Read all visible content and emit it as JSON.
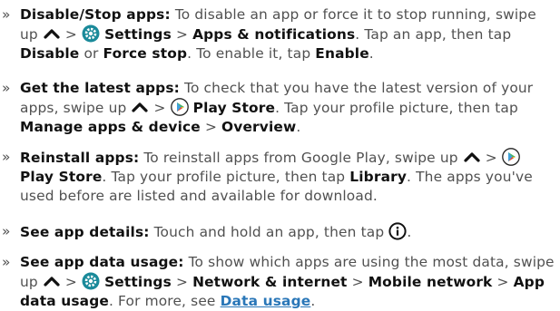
{
  "items": [
    {
      "head": "Disable/Stop apps:",
      "a": "To disable an app or force it to stop running, swipe up",
      "gt1": ">",
      "b1": "Settings",
      "gt2": ">",
      "b2": "Apps & notifications",
      "c": ". Tap an app, then tap",
      "b3": "Disable",
      "or": "or",
      "b4": "Force stop",
      "d": ". To enable it, tap",
      "b5": "Enable",
      "end": "."
    },
    {
      "head": "Get the latest apps:",
      "a": "To check that you have the latest version of your apps, swipe up",
      "gt1": ">",
      "b1": "Play Store",
      "c": ". Tap your profile picture, then tap",
      "b2": "Manage apps & device",
      "gt2": ">",
      "b3": "Overview",
      "end": "."
    },
    {
      "head": "Reinstall apps:",
      "a": "To reinstall apps from Google Play, swipe up",
      "gt1": ">",
      "b1": "Play Store",
      "c": ". Tap your profile picture, then tap",
      "b2": "Library",
      "d": ". The apps you've used before are listed and available for download."
    },
    {
      "head": "See app details:",
      "a": "Touch and hold an app, then tap",
      "end": "."
    },
    {
      "head": "See app data usage:",
      "a": "To show which apps are using the most data, swipe up",
      "gt1": ">",
      "b1": "Settings",
      "gt2": ">",
      "b2": "Network & internet",
      "gt3": ">",
      "b3": "Mobile network",
      "gt4": ">",
      "b4": "App data usage",
      "c": ". For more, see",
      "link": "Data usage",
      "end": "."
    }
  ],
  "bullet": "»",
  "icons": {
    "swipe_up": "chevron-up-icon",
    "settings": "settings-gear-icon",
    "play_store": "play-store-icon",
    "info": "info-icon"
  },
  "colors": {
    "body_text": "#505050",
    "bold_text": "#111111",
    "link": "#2a77b8",
    "settings_icon": "#1a8a9a",
    "play_green": "#48b563",
    "play_blue": "#3fa1dd",
    "play_yellow": "#f6c03a",
    "play_red": "#e8473e"
  }
}
